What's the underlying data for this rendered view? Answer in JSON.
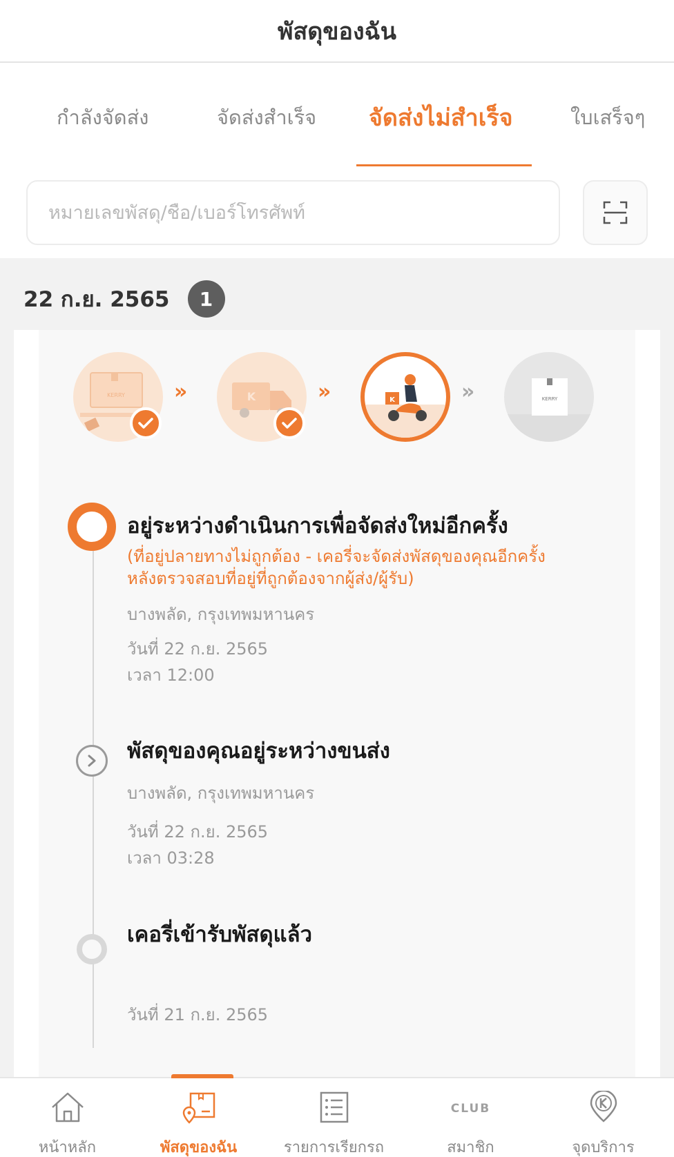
{
  "header": {
    "title": "พัสดุของฉัน"
  },
  "tabs": [
    {
      "label": "กำลังจัดส่ง",
      "active": false
    },
    {
      "label": "จัดส่งสำเร็จ",
      "active": false
    },
    {
      "label": "จัดส่งไม่สำเร็จ",
      "active": true
    },
    {
      "label": "ใบเสร็จๆ",
      "active": false
    }
  ],
  "search": {
    "placeholder": "หมายเลขพัสดุ/ชื่อ/เบอร์โทรศัพท์",
    "value": ""
  },
  "group": {
    "date": "22 ก.ย. 2565",
    "count": "1"
  },
  "progress": {
    "steps": [
      {
        "icon": "parcel-pickup-icon",
        "status": "done"
      },
      {
        "icon": "delivery-truck-icon",
        "status": "done"
      },
      {
        "icon": "courier-scooter-icon",
        "status": "current"
      },
      {
        "icon": "delivered-box-icon",
        "status": "pending"
      }
    ]
  },
  "timeline": [
    {
      "title": "อยู่ระหว่างดำเนินการเพื่อจัดส่งใหม่อีกครั้ง",
      "note_line1": "(ที่อยู่ปลายทางไม่ถูกต้อง - เคอรี่จะจัดส่งพัสดุของคุณอีกครั้ง",
      "note_line2": "หลังตรวจสอบที่อยู่ที่ถูกต้องจากผู้ส่ง/ผู้รับ)",
      "location": "บางพลัด, กรุงเทพมหานคร",
      "date": "วันที่ 22 ก.ย. 2565",
      "time": "เวลา 12:00"
    },
    {
      "title": "พัสดุของคุณอยู่ระหว่างขนส่ง",
      "location": "บางพลัด, กรุงเทพมหานคร",
      "date": "วันที่ 22 ก.ย. 2565",
      "time": "เวลา 03:28"
    },
    {
      "title": "เคอรี่เข้ารับพัสดุแล้ว",
      "date": "วันที่ 21 ก.ย. 2565"
    }
  ],
  "bottom_nav": [
    {
      "label": "หน้าหลัก",
      "icon": "home-icon",
      "active": false
    },
    {
      "label": "พัสดุของฉัน",
      "icon": "my-parcel-icon",
      "active": true
    },
    {
      "label": "รายการเรียกรถ",
      "icon": "list-icon",
      "active": false
    },
    {
      "label": "สมาชิก",
      "icon": "club-icon",
      "active": false,
      "icon_text": "CLUB"
    },
    {
      "label": "จุดบริการ",
      "icon": "service-point-icon",
      "active": false
    }
  ],
  "colors": {
    "accent": "#ee7a30",
    "muted": "#9a9a9a",
    "background": "#f2f2f2"
  }
}
